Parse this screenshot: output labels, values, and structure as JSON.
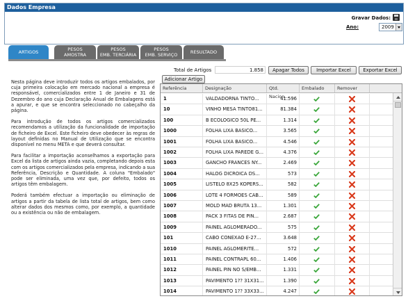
{
  "header": {
    "title": "Dados Empresa",
    "save_label": "Gravar Dados:",
    "year_label": "Ano:",
    "year_value": "2009"
  },
  "tabs": [
    {
      "line1": "ARTIGOS",
      "line2": ""
    },
    {
      "line1": "PESOS",
      "line2": "AMOSTRA"
    },
    {
      "line1": "PESOS",
      "line2": "EMB. TERCIÁRIA"
    },
    {
      "line1": "PESOS",
      "line2": "EMB. SERVIÇO"
    },
    {
      "line1": "RESULTADO",
      "line2": ""
    }
  ],
  "intro": [
    "Nesta página deve introduzir todos os artigos embalados, por cuja primeira colocação em mercado nacional a empresa é responsável, comercializados entre 1 de Janeiro e 31 de Dezembro do ano cuja Declaração Anual de Embalagens está a apurar, e que se encontra seleccionado no cabeçalho da página.",
    "Para introdução de todos os artigos comercializados recomendamos a utilização da funcionalidade de importação de ficheiro de Excel. Este ficheiro deve obedecer às regras de layout definidas no Manual de Utilização que se encontra disponível no menu META e que deverá consultar.",
    "Para facilitar a importação aconselhamos a exportação para Excel da lista de artigos ainda vazia, completando depois esta com os artigos comercializados pela empresa, indicando a sua Referência, Descrição e Quantidade. A coluna \"Embalado\" pode ser eliminada, uma vez que, por defeito, todos os artigos têm embalagem.",
    "Poderá também efectuar a importação ou eliminação de artigos a partir da tabela de lista total de artigos, bem como alterar dados dos mesmos como, por exemplo, a quantidade ou a existência ou não de embalagem."
  ],
  "toolbar": {
    "total_label": "Total de Artigos",
    "total_value": "1.858",
    "clear_all": "Apagar Todos",
    "import_excel": "Importar Excel",
    "export_excel": "Exportar Excel",
    "add_article": "Adicionar Artigo"
  },
  "table": {
    "columns": [
      "Referência",
      "Designação",
      "Qtd. Nacion...",
      "Embalado",
      "Remover"
    ],
    "rows": [
      {
        "ref": "1",
        "des": "VALDADORNA TINTO...",
        "qty": "41.596"
      },
      {
        "ref": "10",
        "des": "VINHO MESA TINTO81...",
        "qty": "81.384"
      },
      {
        "ref": "100",
        "des": "B ECOLOGICO 50L PE...",
        "qty": "1.314"
      },
      {
        "ref": "1000",
        "des": "FOLHA LIXA BASICO...",
        "qty": "3.565"
      },
      {
        "ref": "1001",
        "des": "FOLHA LIXA BASICO...",
        "qty": "4.546"
      },
      {
        "ref": "1002",
        "des": "FOLHA LIXA PAREDE G...",
        "qty": "4.376"
      },
      {
        "ref": "1003",
        "des": "GANCHO FRANCES NY...",
        "qty": "2.469"
      },
      {
        "ref": "1004",
        "des": "HALOG DICROICA DS...",
        "qty": "573"
      },
      {
        "ref": "1005",
        "des": "LISTELO 8X25 KOPERS...",
        "qty": "582"
      },
      {
        "ref": "1006",
        "des": "LOTE 4 FORMOES CAB...",
        "qty": "589"
      },
      {
        "ref": "1007",
        "des": "MOLD MAD BRUTA 13...",
        "qty": "1.301"
      },
      {
        "ref": "1008",
        "des": "PACK 3 FITAS DE PIN...",
        "qty": "2.687"
      },
      {
        "ref": "1009",
        "des": "PAINEL AGLOMERADO...",
        "qty": "575"
      },
      {
        "ref": "101",
        "des": "CABO CONEXAO E-27...",
        "qty": "3.648"
      },
      {
        "ref": "1010",
        "des": "PAINEL AGLOMERITE...",
        "qty": "572"
      },
      {
        "ref": "1011",
        "des": "PAINEL CONTRAPL 60...",
        "qty": "1.406"
      },
      {
        "ref": "1012",
        "des": "PAINEL PIN NO S/EMB...",
        "qty": "1.331"
      },
      {
        "ref": "1013",
        "des": "PAVIMENTO 1?? 31X31...",
        "qty": "1.390"
      },
      {
        "ref": "1014",
        "des": "PAVIMENTO 1?? 33X33...",
        "qty": "4.247"
      }
    ]
  },
  "colors": {
    "header_bar": "#1d5f9d",
    "tab_active": "#2f86c7",
    "tab_inactive": "#6b6b6b",
    "check": "#3aa63a",
    "remove": "#d93a1c"
  },
  "icons": {
    "save": "floppy-disk-icon",
    "embalado": "checkmark-icon",
    "remover": "red-x-icon"
  }
}
